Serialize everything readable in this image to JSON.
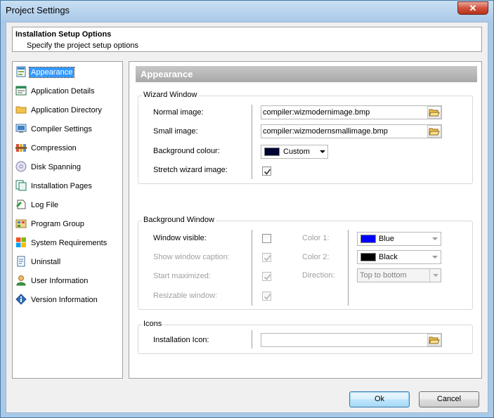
{
  "window": {
    "title": "Project Settings",
    "close_symbol": "✕"
  },
  "header": {
    "title": "Installation Setup Options",
    "subtitle": "Specify the project setup options"
  },
  "nav": {
    "items": [
      {
        "label": "Appearance",
        "icon": "appearance-icon"
      },
      {
        "label": "Application Details",
        "icon": "application-details-icon"
      },
      {
        "label": "Application Directory",
        "icon": "folder-icon"
      },
      {
        "label": "Compiler Settings",
        "icon": "compiler-settings-icon"
      },
      {
        "label": "Compression",
        "icon": "compression-icon"
      },
      {
        "label": "Disk Spanning",
        "icon": "disk-icon"
      },
      {
        "label": "Installation Pages",
        "icon": "pages-icon"
      },
      {
        "label": "Log File",
        "icon": "log-file-icon"
      },
      {
        "label": "Program Group",
        "icon": "program-group-icon"
      },
      {
        "label": "System Requirements",
        "icon": "windows-icon"
      },
      {
        "label": "Uninstall",
        "icon": "uninstall-icon"
      },
      {
        "label": "User Information",
        "icon": "user-icon"
      },
      {
        "label": "Version Information",
        "icon": "version-info-icon"
      }
    ],
    "selected": "Appearance"
  },
  "content": {
    "title": "Appearance",
    "wizard": {
      "group_title": "Wizard Window",
      "normal_image_label": "Normal image:",
      "normal_image_value": "compiler:wizmodernimage.bmp",
      "small_image_label": "Small image:",
      "small_image_value": "compiler:wizmodernsmallimage.bmp",
      "bg_colour_label": "Background colour:",
      "bg_colour_value": "Custom",
      "bg_colour_color": "#000033",
      "stretch_label": "Stretch wizard image:",
      "stretch_checked": true
    },
    "background": {
      "group_title": "Background Window",
      "window_visible_label": "Window visible:",
      "show_caption_label": "Show window caption:",
      "start_maximized_label": "Start maximized:",
      "resizable_label": "Resizable window:",
      "color1_label": "Color 1:",
      "color1_value": "Blue",
      "color1_color": "#0000ff",
      "color2_label": "Color 2:",
      "color2_value": "Black",
      "color2_color": "#000000",
      "direction_label": "Direction:",
      "direction_value": "Top to bottom"
    },
    "icons": {
      "group_title": "Icons",
      "installation_icon_label": "Installation Icon:",
      "installation_icon_value": ""
    }
  },
  "buttons": {
    "ok": "Ok",
    "cancel": "Cancel"
  }
}
